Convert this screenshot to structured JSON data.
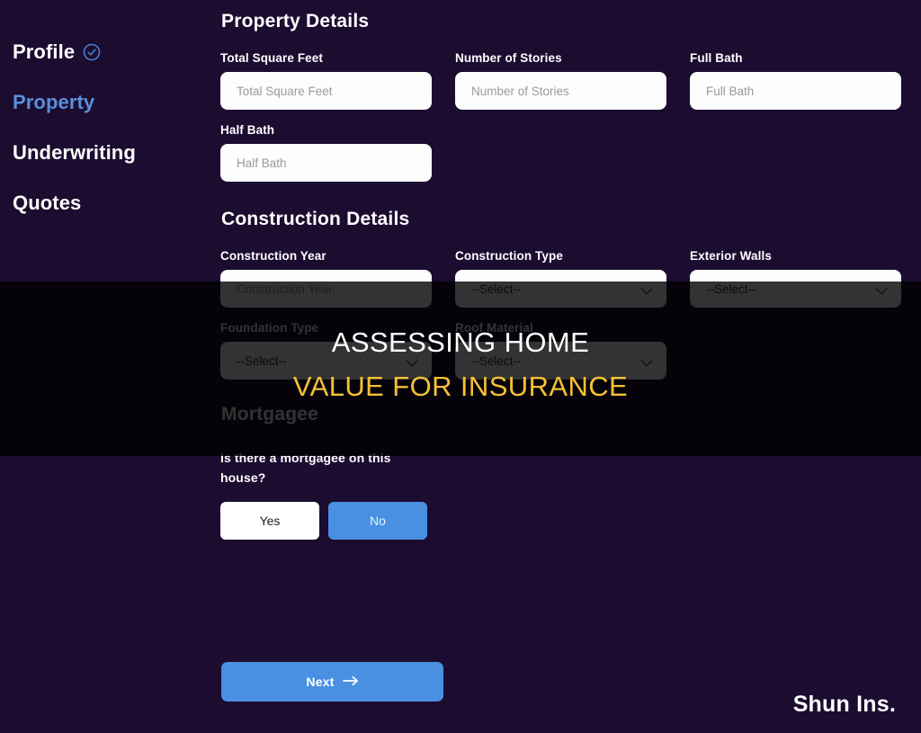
{
  "sidebar": {
    "items": [
      {
        "label": "Profile",
        "state": "completed",
        "icon": "check-circle-icon"
      },
      {
        "label": "Property",
        "state": "active",
        "icon": ""
      },
      {
        "label": "Underwriting",
        "state": "default",
        "icon": ""
      },
      {
        "label": "Quotes",
        "state": "default",
        "icon": ""
      }
    ]
  },
  "property_details": {
    "title": "Property Details",
    "fields": [
      {
        "label": "Total Square Feet",
        "placeholder": "Total Square Feet",
        "value": "",
        "type": "text"
      },
      {
        "label": "Number of Stories",
        "placeholder": "Number of Stories",
        "value": "",
        "type": "text"
      },
      {
        "label": "Full Bath",
        "placeholder": "Full Bath",
        "value": "",
        "type": "text"
      },
      {
        "label": "Half Bath",
        "placeholder": "Half Bath",
        "value": "",
        "type": "text"
      }
    ]
  },
  "construction_details": {
    "title": "Construction Details",
    "fields": [
      {
        "label": "Construction Year",
        "placeholder": "Construction Year",
        "value": "",
        "type": "text"
      },
      {
        "label": "Construction Type",
        "value": "--Select--",
        "type": "select"
      },
      {
        "label": "Exterior Walls",
        "value": "--Select--",
        "type": "select"
      },
      {
        "label": "Foundation Type",
        "value": "--Select--",
        "type": "select"
      },
      {
        "label": "Roof Material",
        "value": "--Select--",
        "type": "select"
      }
    ]
  },
  "mortgagee": {
    "title": "Mortgagee",
    "question": "Is there a mortgagee on this house?",
    "yes_label": "Yes",
    "no_label": "No",
    "selected": "No"
  },
  "footer": {
    "next_label": "Next",
    "next_icon": "arrow-right-icon"
  },
  "overlay": {
    "line1": "ASSESSING HOME",
    "line2": "VALUE FOR INSURANCE",
    "line1_color": "#ffffff",
    "line2_color": "#f5c033"
  },
  "watermark": {
    "text": "Shun Ins."
  },
  "theme": {
    "background": "#1b0c30",
    "accent_blue": "#4a90e2",
    "active_link": "#5b8fd9",
    "gold": "#f5c033"
  }
}
